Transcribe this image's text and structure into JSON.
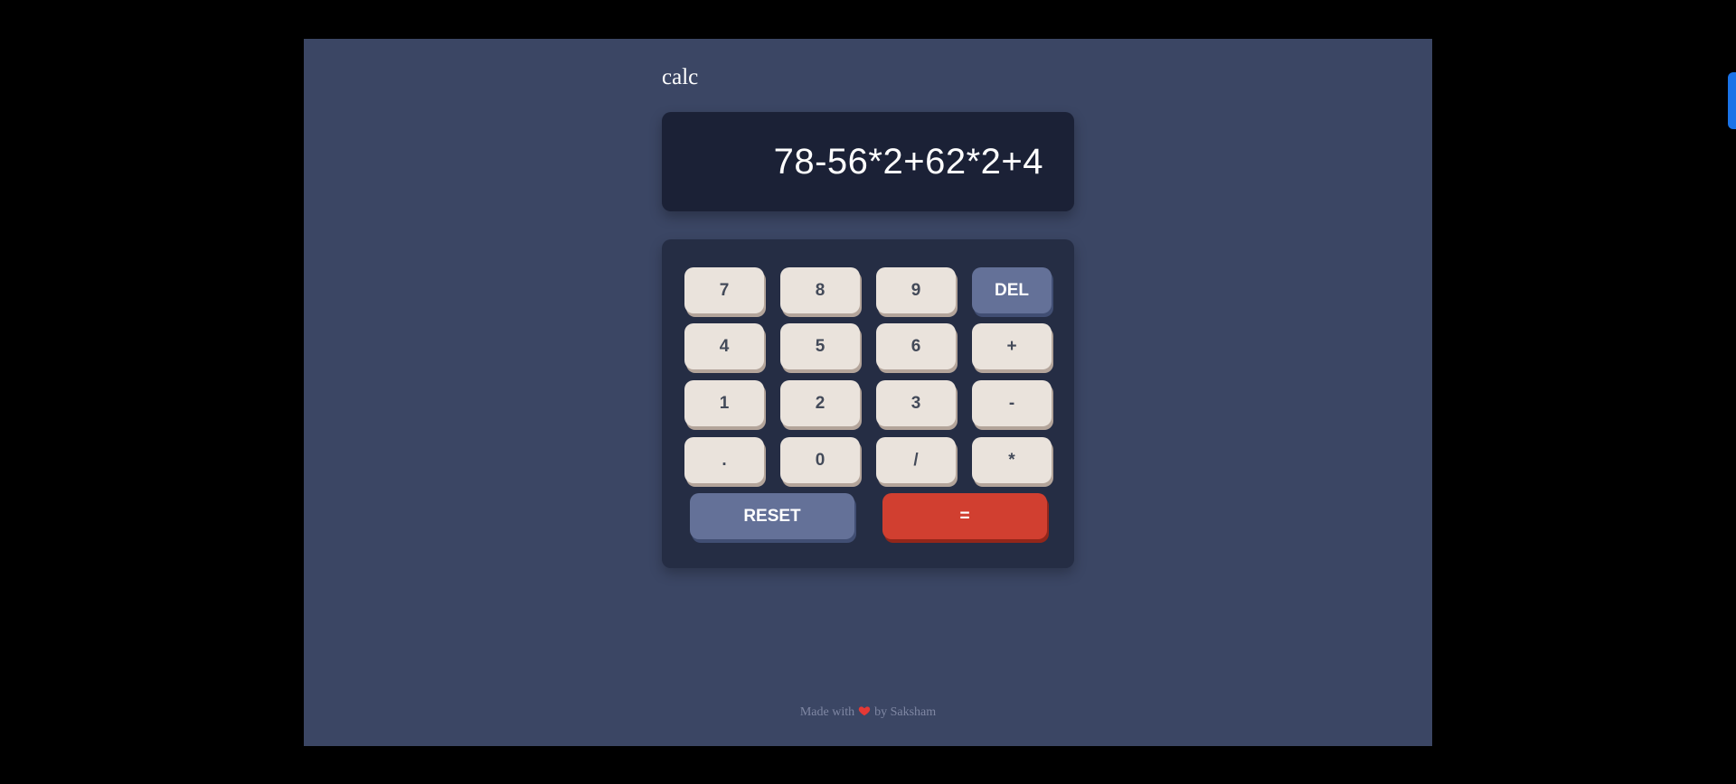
{
  "app": {
    "title": "calc"
  },
  "display": {
    "value": "78-56*2+62*2+4"
  },
  "keypad": {
    "rows": [
      [
        "7",
        "8",
        "9",
        "DEL"
      ],
      [
        "4",
        "5",
        "6",
        "+"
      ],
      [
        "1",
        "2",
        "3",
        "-"
      ],
      [
        ".",
        "0",
        "/",
        "*"
      ]
    ],
    "reset_label": "RESET",
    "equals_label": "="
  },
  "footer": {
    "made_with": "Made with",
    "by": "by Saksham",
    "icon": "heart-icon"
  },
  "colors": {
    "page_background": "#3b4664",
    "screen_background": "#1b2136",
    "keypad_background": "#252d44",
    "key_background": "#eae3dc",
    "key_text": "#434a59",
    "accent_key": "#647198",
    "equals_key": "#d13f30",
    "heart": "#e53935"
  }
}
